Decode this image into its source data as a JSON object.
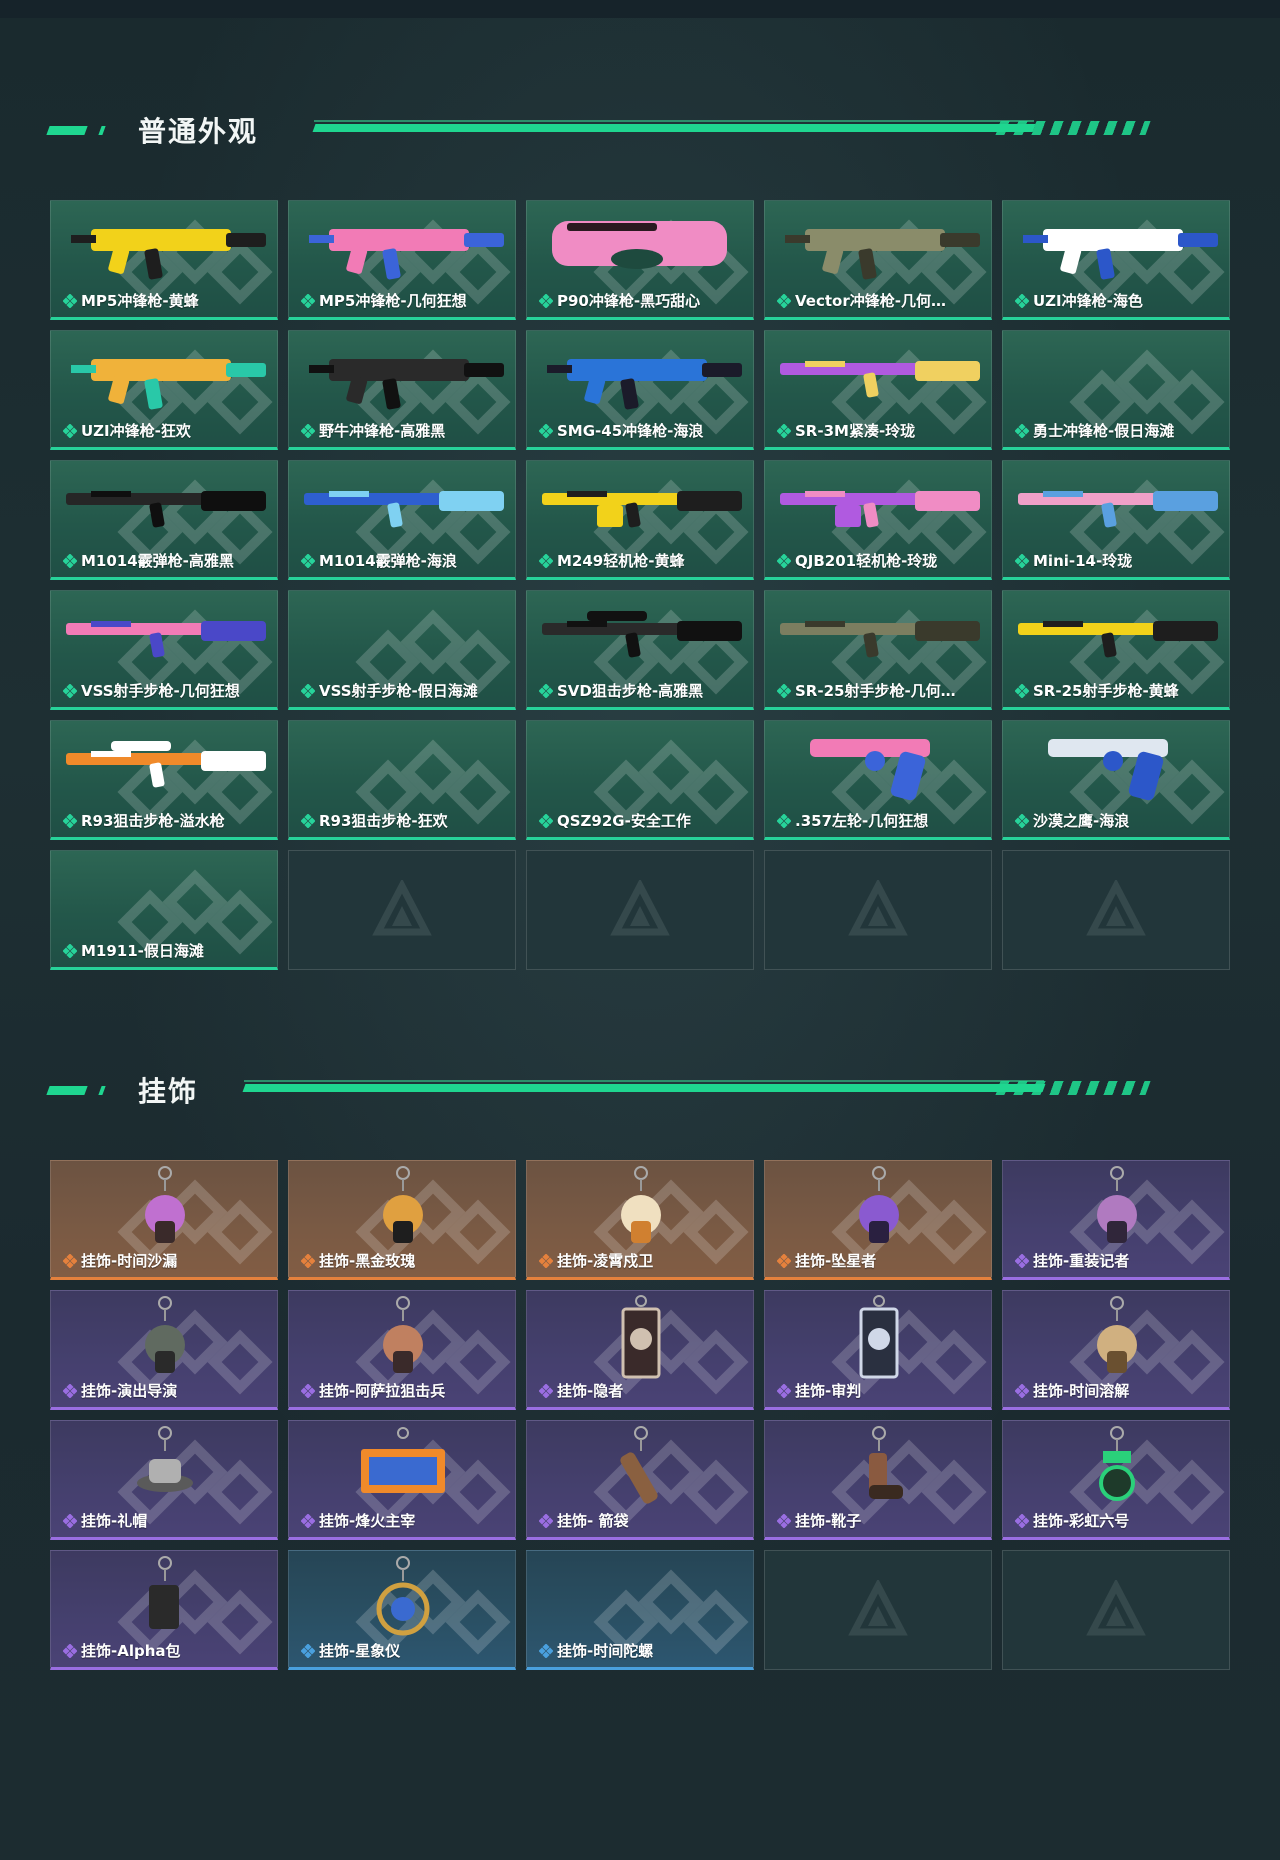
{
  "sections": [
    {
      "title": "普通外观",
      "items": [
        {
          "label": "MP5冲锋枪-黄蜂",
          "rarity": "green",
          "icon": "mp5-wasp-skin",
          "colors": [
            "#f2d21a",
            "#1e1e1e"
          ],
          "kind": "smg"
        },
        {
          "label": "MP5冲锋枪-几何狂想",
          "rarity": "green",
          "icon": "mp5-geometric-skin",
          "colors": [
            "#f27bb6",
            "#3b64d9"
          ],
          "kind": "smg"
        },
        {
          "label": "P90冲锋枪-黑巧甜心",
          "rarity": "green",
          "icon": "p90-chocolate-skin",
          "colors": [
            "#f08cc4",
            "#2a1a20"
          ],
          "kind": "p90"
        },
        {
          "label": "Vector冲锋枪-几何…",
          "rarity": "green",
          "icon": "vector-camo-skin",
          "colors": [
            "#8a8c6a",
            "#3a3a2c"
          ],
          "kind": "vector"
        },
        {
          "label": "UZI冲锋枪-海色",
          "rarity": "green",
          "icon": "uzi-sea-skin",
          "colors": [
            "#ffffff",
            "#2c57c9"
          ],
          "kind": "uzi"
        },
        {
          "label": "UZI冲锋枪-狂欢",
          "rarity": "green",
          "icon": "uzi-carnival-skin",
          "colors": [
            "#f0b23a",
            "#29c8a8"
          ],
          "kind": "uzi"
        },
        {
          "label": "野牛冲锋枪-高雅黑",
          "rarity": "green",
          "icon": "bizon-black-skin",
          "colors": [
            "#2a2a2a",
            "#111111"
          ],
          "kind": "smg"
        },
        {
          "label": "SMG-45冲锋枪-海浪",
          "rarity": "green",
          "icon": "smg45-wave-skin",
          "colors": [
            "#2a74d8",
            "#1b1b2a"
          ],
          "kind": "smg"
        },
        {
          "label": "SR-3M紧凑-玲珑",
          "rarity": "green",
          "icon": "sr3m-exquisite-skin",
          "colors": [
            "#b05ae0",
            "#f0d060"
          ],
          "kind": "rifle"
        },
        {
          "label": "勇士冲锋枪-假日海滩",
          "rarity": "green",
          "icon": "",
          "colors": [],
          "kind": "none"
        },
        {
          "label": "M1014霰弹枪-高雅黑",
          "rarity": "green",
          "icon": "m1014-black-skin",
          "colors": [
            "#262626",
            "#0f0f0f"
          ],
          "kind": "shotgun"
        },
        {
          "label": "M1014霰弹枪-海浪",
          "rarity": "green",
          "icon": "m1014-wave-skin",
          "colors": [
            "#2e5fd0",
            "#7fd1f2"
          ],
          "kind": "shotgun"
        },
        {
          "label": "M249轻机枪-黄蜂",
          "rarity": "green",
          "icon": "m249-wasp-skin",
          "colors": [
            "#f2d21a",
            "#1e1e1e"
          ],
          "kind": "lmg"
        },
        {
          "label": "QJB201轻机枪-玲珑",
          "rarity": "green",
          "icon": "qjb201-exquisite-skin",
          "colors": [
            "#b05ae0",
            "#f08cc4"
          ],
          "kind": "lmg"
        },
        {
          "label": "Mini-14-玲珑",
          "rarity": "green",
          "icon": "mini14-exquisite-skin",
          "colors": [
            "#f0a0c8",
            "#5aa0e0"
          ],
          "kind": "rifle"
        },
        {
          "label": "VSS射手步枪-几何狂想",
          "rarity": "green",
          "icon": "vss-geometric-skin",
          "colors": [
            "#f27bb6",
            "#4a48c8"
          ],
          "kind": "rifle"
        },
        {
          "label": "VSS射手步枪-假日海滩",
          "rarity": "green",
          "icon": "",
          "colors": [],
          "kind": "none"
        },
        {
          "label": "SVD狙击步枪-高雅黑",
          "rarity": "green",
          "icon": "svd-black-skin",
          "colors": [
            "#2a2a2a",
            "#111111"
          ],
          "kind": "sniper"
        },
        {
          "label": "SR-25射手步枪-几何…",
          "rarity": "green",
          "icon": "sr25-camo-skin",
          "colors": [
            "#7c7e60",
            "#3a3a2c"
          ],
          "kind": "rifle"
        },
        {
          "label": "SR-25射手步枪-黄蜂",
          "rarity": "green",
          "icon": "sr25-wasp-skin",
          "colors": [
            "#f2d21a",
            "#1e1e1e"
          ],
          "kind": "rifle"
        },
        {
          "label": "R93狙击步枪-溢水枪",
          "rarity": "green",
          "icon": "r93-watergun-skin",
          "colors": [
            "#f08a2a",
            "#ffffff"
          ],
          "kind": "sniper"
        },
        {
          "label": "R93狙击步枪-狂欢",
          "rarity": "green",
          "icon": "",
          "colors": [],
          "kind": "none"
        },
        {
          "label": "QSZ92G-安全工作",
          "rarity": "green",
          "icon": "",
          "colors": [],
          "kind": "none"
        },
        {
          "label": ".357左轮-几何狂想",
          "rarity": "green",
          "icon": "revolver-geometric-skin",
          "colors": [
            "#f27bb6",
            "#3b64d9"
          ],
          "kind": "revolver"
        },
        {
          "label": "沙漠之鹰-海浪",
          "rarity": "green",
          "icon": "deagle-wave-skin",
          "colors": [
            "#dfe7f0",
            "#2c57c9"
          ],
          "kind": "pistol"
        },
        {
          "label": "M1911-假日海滩",
          "rarity": "green",
          "icon": "",
          "colors": [],
          "kind": "none"
        },
        {
          "label": "",
          "rarity": "empty",
          "icon": "placeholder-logo-icon",
          "colors": [],
          "kind": "none"
        },
        {
          "label": "",
          "rarity": "empty",
          "icon": "placeholder-logo-icon",
          "colors": [],
          "kind": "none"
        },
        {
          "label": "",
          "rarity": "empty",
          "icon": "placeholder-logo-icon",
          "colors": [],
          "kind": "none"
        },
        {
          "label": "",
          "rarity": "empty",
          "icon": "placeholder-logo-icon",
          "colors": [],
          "kind": "none"
        }
      ]
    },
    {
      "title": "挂饰",
      "items": [
        {
          "label": "挂饰-时间沙漏",
          "rarity": "orange",
          "icon": "hourglass-charm",
          "colors": [
            "#c070d0",
            "#3a2a2a"
          ],
          "kind": "charm"
        },
        {
          "label": "挂饰-黑金玫瑰",
          "rarity": "orange",
          "icon": "black-gold-rose-charm",
          "colors": [
            "#e0a040",
            "#1e1e1e"
          ],
          "kind": "charm"
        },
        {
          "label": "挂饰-凌霄戍卫",
          "rarity": "orange",
          "icon": "sky-guard-charm",
          "colors": [
            "#f0e0c0",
            "#d08030"
          ],
          "kind": "charm"
        },
        {
          "label": "挂饰-坠星者",
          "rarity": "orange",
          "icon": "fallen-star-charm",
          "colors": [
            "#8a5ad0",
            "#2a2040"
          ],
          "kind": "charm"
        },
        {
          "label": "挂饰-重装记者",
          "rarity": "purple",
          "icon": "heavy-reporter-charm",
          "colors": [
            "#b07ac0",
            "#30263a"
          ],
          "kind": "charm"
        },
        {
          "label": "挂饰-演出导演",
          "rarity": "purple",
          "icon": "director-charm",
          "colors": [
            "#606a60",
            "#2a2a2a"
          ],
          "kind": "charm"
        },
        {
          "label": "挂饰-阿萨拉狙击兵",
          "rarity": "purple",
          "icon": "asala-sniper-charm",
          "colors": [
            "#c08060",
            "#3a2a2a"
          ],
          "kind": "charm"
        },
        {
          "label": "挂饰-隐者",
          "rarity": "purple",
          "icon": "hermit-card-charm",
          "colors": [
            "#d0c0b0",
            "#3a2a2a"
          ],
          "kind": "card"
        },
        {
          "label": "挂饰-审判",
          "rarity": "purple",
          "icon": "judgement-card-charm",
          "colors": [
            "#d0d8e8",
            "#2a3040"
          ],
          "kind": "card"
        },
        {
          "label": "挂饰-时间溶解",
          "rarity": "purple",
          "icon": "melting-clock-charm",
          "colors": [
            "#d0b080",
            "#6a5030"
          ],
          "kind": "charm"
        },
        {
          "label": "挂饰-礼帽",
          "rarity": "purple",
          "icon": "top-hat-charm",
          "colors": [
            "#b0b0b0",
            "#5a5a5a"
          ],
          "kind": "hat"
        },
        {
          "label": "挂饰-烽火主宰",
          "rarity": "purple",
          "icon": "beacon-ruler-charm",
          "colors": [
            "#f08a2a",
            "#3a6ad0"
          ],
          "kind": "banner"
        },
        {
          "label": "挂饰- 箭袋",
          "rarity": "purple",
          "icon": "quiver-charm",
          "colors": [
            "#8a6040",
            "#3a2a20"
          ],
          "kind": "quiver"
        },
        {
          "label": "挂饰-靴子",
          "rarity": "purple",
          "icon": "boot-charm",
          "colors": [
            "#8a5a40",
            "#3a2a20"
          ],
          "kind": "boot"
        },
        {
          "label": "挂饰-彩虹六号",
          "rarity": "purple",
          "icon": "rainbow-six-charm",
          "colors": [
            "#2ad07a",
            "#1e3a2a"
          ],
          "kind": "six"
        },
        {
          "label": "挂饰-Alpha包",
          "rarity": "purple",
          "icon": "alpha-pack-charm",
          "colors": [
            "#2a2a2a",
            "#8a8a8a"
          ],
          "kind": "pack"
        },
        {
          "label": "挂饰-星象仪",
          "rarity": "blue",
          "icon": "astrolabe-charm",
          "colors": [
            "#d0a040",
            "#3a6ad0"
          ],
          "kind": "astrolabe"
        },
        {
          "label": "挂饰-时间陀螺",
          "rarity": "blue",
          "icon": "",
          "colors": [],
          "kind": "none"
        },
        {
          "label": "",
          "rarity": "empty",
          "icon": "placeholder-logo-icon",
          "colors": [],
          "kind": "none"
        },
        {
          "label": "",
          "rarity": "empty",
          "icon": "placeholder-logo-icon",
          "colors": [],
          "kind": "none"
        }
      ]
    }
  ],
  "rarity_colors": {
    "green": "#27d39a",
    "orange": "#e5813d",
    "purple": "#9a6ee2",
    "blue": "#4aa0de"
  }
}
